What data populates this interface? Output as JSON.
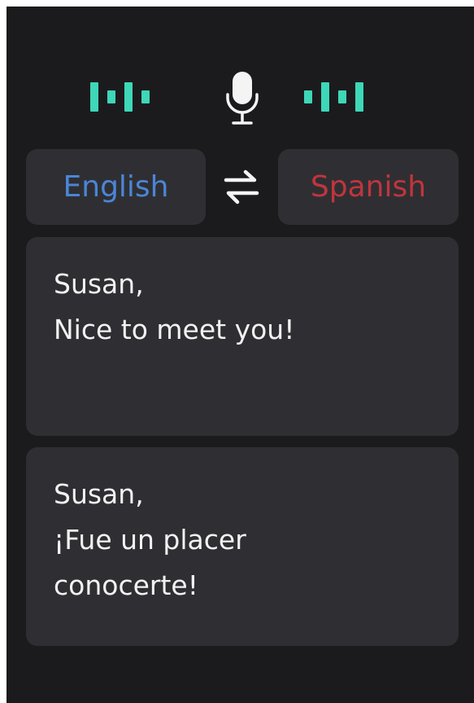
{
  "source_language": "English",
  "target_language": "Spanish",
  "colors": {
    "background": "#1b1b1d",
    "card": "#2f2f33",
    "wave_accent": "#3ed7b8",
    "source_language_color": "#4a86d6",
    "target_language_color": "#c1353c",
    "text": "#f2f2f2"
  },
  "icons": {
    "microphone": "microphone-icon",
    "swap": "swap-languages-icon",
    "waveform": "sound-wave-icon"
  },
  "source_text": {
    "line1": "Susan,",
    "line2": "Nice to meet you!"
  },
  "translated_text": {
    "line1": "Susan,",
    "line2": "¡Fue un placer",
    "line3": "conocerte!"
  }
}
